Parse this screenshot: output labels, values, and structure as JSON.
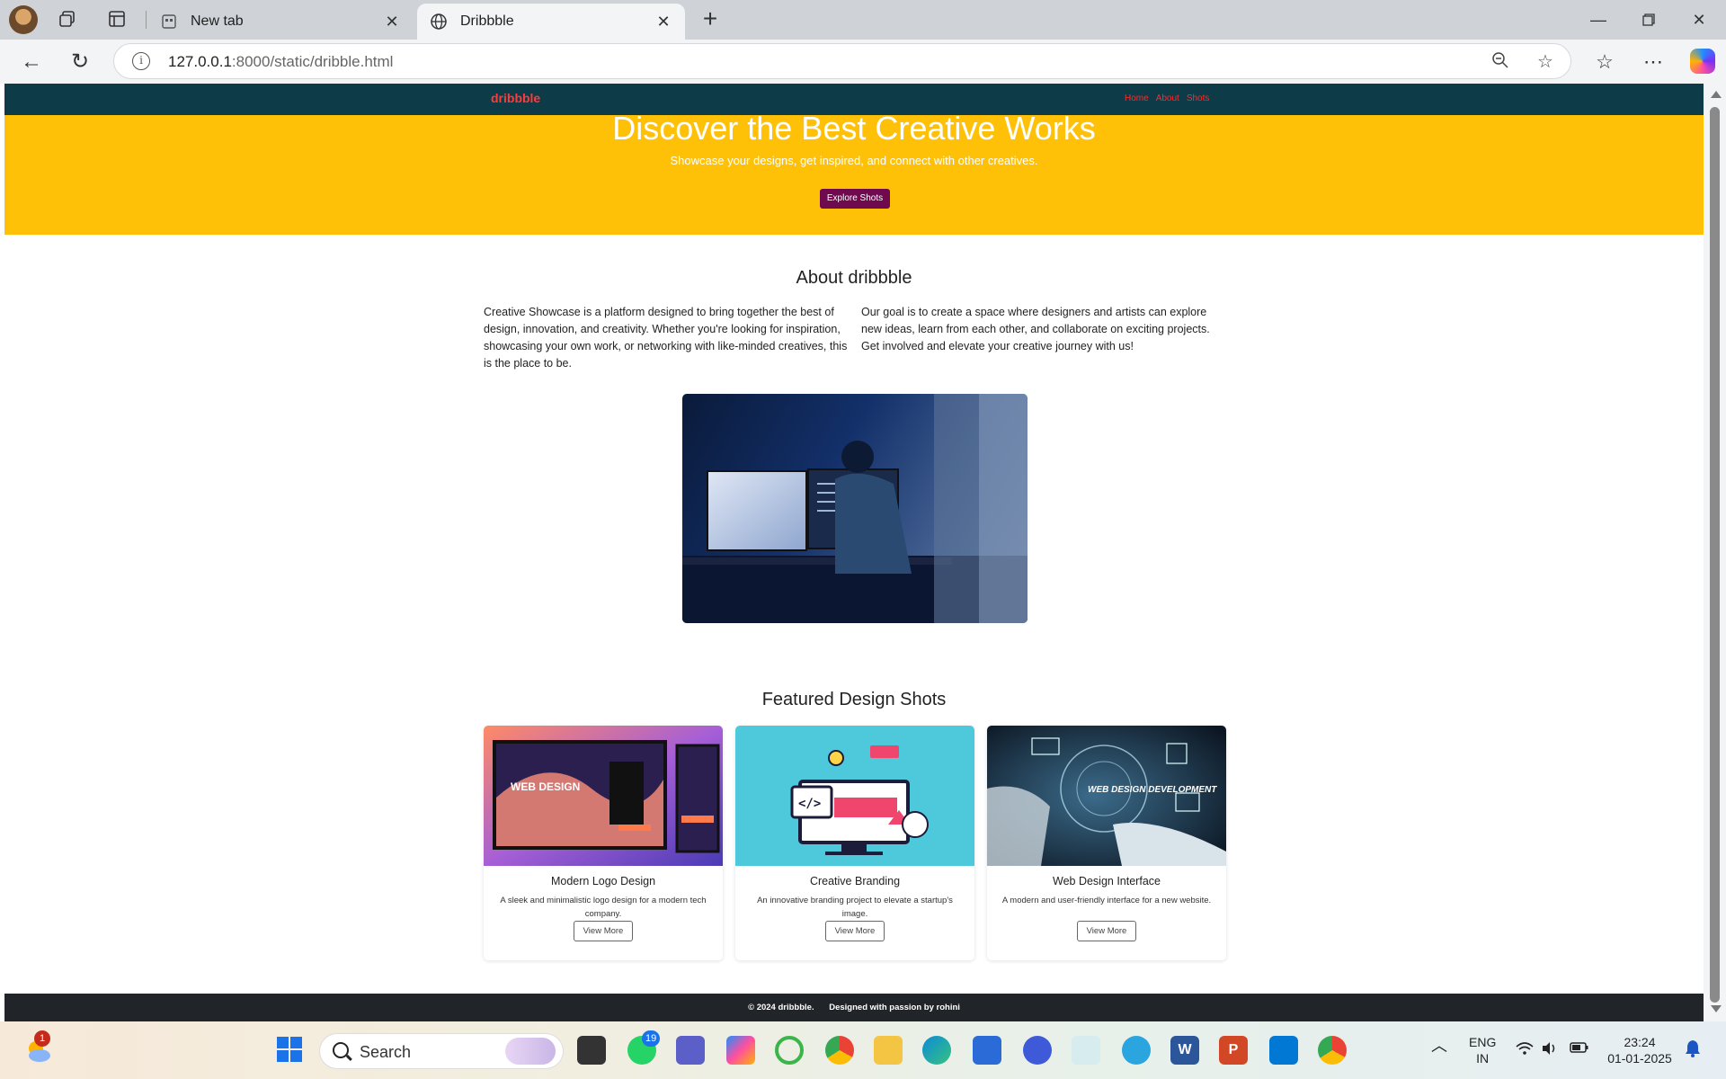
{
  "browser": {
    "tabs": [
      {
        "title": "New tab",
        "active": false
      },
      {
        "title": "Dribbble",
        "active": true
      }
    ],
    "url_host": "127.0.0.1",
    "url_rest": ":8000/static/dribble.html"
  },
  "site": {
    "logo": "dribbble",
    "nav": [
      "Home",
      "About",
      "Shots"
    ],
    "hero": {
      "title": "Discover the Best Creative Works",
      "subtitle": "Showcase your designs, get inspired, and connect with other creatives.",
      "cta": "Explore Shots"
    },
    "about": {
      "title": "About dribbble",
      "col1": "Creative Showcase is a platform designed to bring together the best of design, innovation, and creativity. Whether you're looking for inspiration, showcasing your own work, or networking with like-minded creatives, this is the place to be.",
      "col2": "Our goal is to create a space where designers and artists can explore new ideas, learn from each other, and collaborate on exciting projects. Get involved and elevate your creative journey with us!"
    },
    "featured": {
      "title": "Featured Design Shots",
      "cards": [
        {
          "title": "Modern Logo Design",
          "desc": "A sleek and minimalistic logo design for a modern tech company.",
          "button": "View More",
          "thumb_text": "WEB DESIGN"
        },
        {
          "title": "Creative Branding",
          "desc": "An innovative branding project to elevate a startup's image.",
          "button": "View More",
          "thumb_text": "</>"
        },
        {
          "title": "Web Design Interface",
          "desc": "A modern and user-friendly interface for a new website.",
          "button": "View More",
          "thumb_text": "WEB DESIGN DEVELOPMENT"
        }
      ]
    },
    "footer": {
      "copyright": "© 2024 dribbble.",
      "credit": "Designed with passion by rohini"
    }
  },
  "taskbar": {
    "search_label": "Search",
    "weather_badge": "1",
    "whatsapp_badge": "19",
    "lang_line1": "ENG",
    "lang_line2": "IN",
    "time": "23:24",
    "date": "01-01-2025"
  }
}
